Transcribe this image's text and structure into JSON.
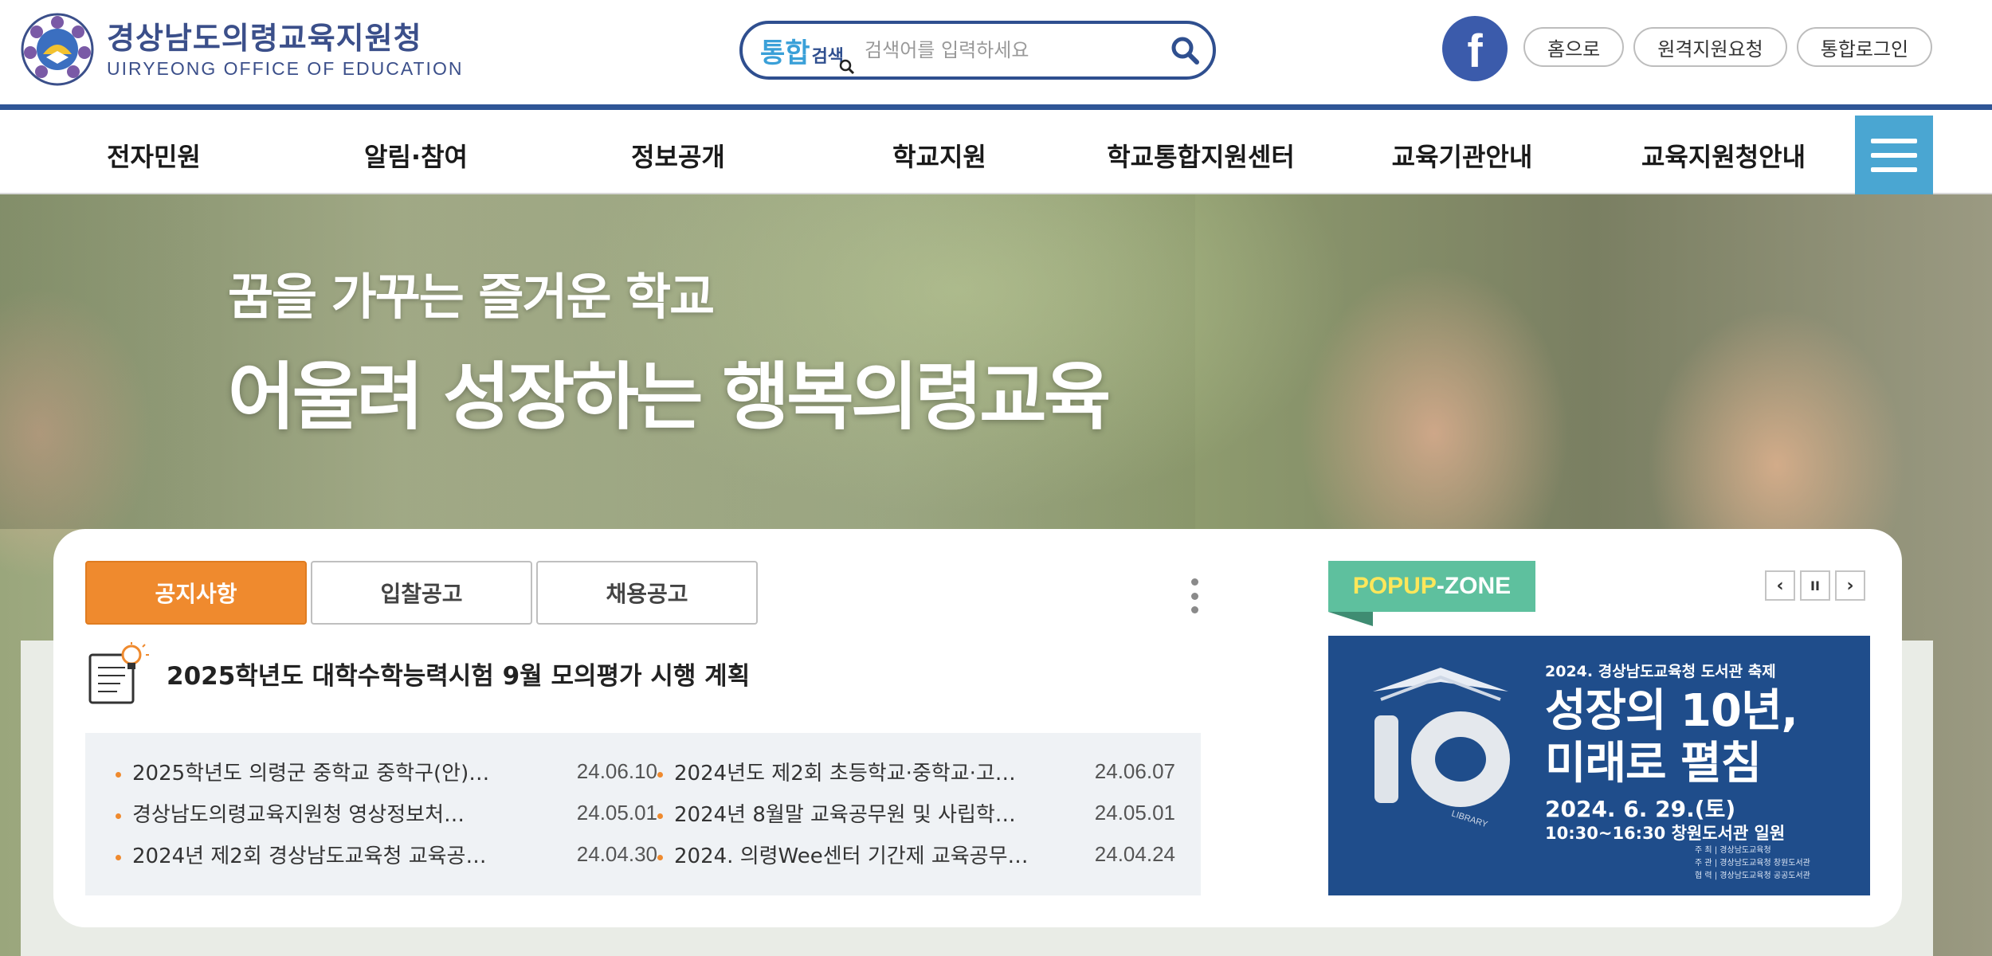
{
  "header": {
    "logo_kr": "경상남도의령교육지원청",
    "logo_en": "UIRYEONG OFFICE OF EDUCATION",
    "search": {
      "brand_a": "통합",
      "brand_b": "검색",
      "placeholder": "검색어를 입력하세요"
    },
    "facebook_letter": "f",
    "links": [
      "홈으로",
      "원격지원요청",
      "통합로그인"
    ],
    "accent_color": "#2f5596"
  },
  "nav": {
    "items": [
      "전자민원",
      "알림·참여",
      "정보공개",
      "학교지원",
      "학교통합지원센터",
      "교육기관안내",
      "교육지원청안내"
    ],
    "menu_button_color": "#4aa6d2"
  },
  "hero": {
    "subtitle": "꿈을 가꾸는 즐거운 학교",
    "title": "어울려 성장하는 행복의령교육"
  },
  "notices": {
    "tabs": [
      "공지사항",
      "입찰공고",
      "채용공고"
    ],
    "active_tab": "공지사항",
    "active_color": "#ef8a2e",
    "featured": "2025학년도 대학수학능력시험 9월 모의평가 시행 계획",
    "list": [
      {
        "title": "2025학년도 의령군 중학교 중학구(안)…",
        "date": "24.06.10"
      },
      {
        "title": "2024년도 제2회 초등학교·중학교·고…",
        "date": "24.06.07"
      },
      {
        "title": "경상남도의령교육지원청 영상정보처…",
        "date": "24.05.01"
      },
      {
        "title": "2024년 8월말 교육공무원 및 사립학…",
        "date": "24.05.01"
      },
      {
        "title": "2024년 제2회 경상남도교육청 교육공…",
        "date": "24.04.30"
      },
      {
        "title": "2024. 의령Wee센터 기간제 교육공무…",
        "date": "24.04.24"
      }
    ]
  },
  "popup": {
    "label_a": "POPUP",
    "label_b": "-ZONE",
    "controls": [
      "‹",
      "II",
      "›"
    ],
    "banner": {
      "top": "2024. 경상남도교육청 도서관 축제",
      "line1": "성장의 10년,",
      "line2": "미래로 펼침",
      "date": "2024. 6. 29.(토)",
      "time": "10:30~16:30 창원도서관 일원",
      "ring_text": "LIBRARY",
      "footer": [
        "주 최 | 경상남도교육청",
        "주 관 | 경상남도교육청 창원도서관",
        "협 력 | 경상남도교육청 공공도서관"
      ]
    }
  }
}
